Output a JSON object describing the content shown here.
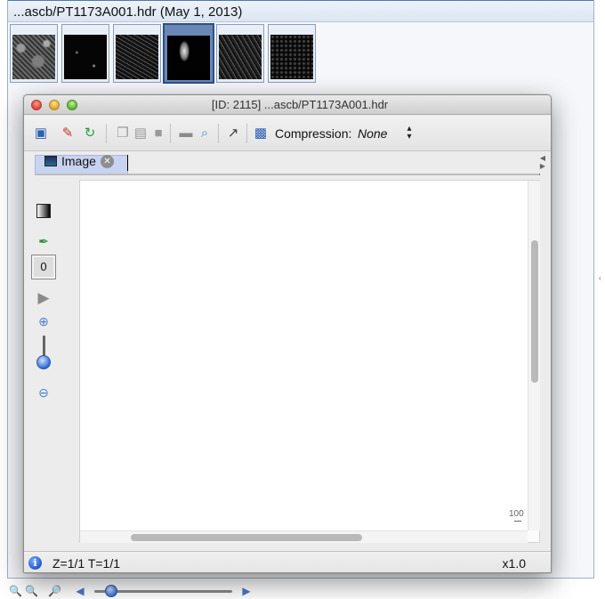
{
  "background_window": {
    "title": "...ascb/PT1173A001.hdr (May 1, 2013)",
    "thumbnails": [
      {
        "selected": false
      },
      {
        "selected": false
      },
      {
        "selected": false
      },
      {
        "selected": true
      },
      {
        "selected": false
      },
      {
        "selected": false
      }
    ],
    "bottom_toolbar": {
      "icons": [
        "zoom-out-icon",
        "zoom-in-icon",
        "zoom-fit-icon",
        "arrow-left-icon",
        "arrow-right-icon"
      ],
      "slider_value_fraction": 0.13
    }
  },
  "viewer": {
    "title": "[ID: 2115] ...ascb/PT1173A001.hdr",
    "toolbar": {
      "icons": [
        "measurement-icon",
        "annotate-icon",
        "refresh-icon",
        "copy-icon",
        "paste-icon",
        "save-icon",
        "movie-icon",
        "search-icon",
        "picker-icon",
        "screenshot-icon"
      ],
      "compression_label": "Compression:",
      "compression_value": "None"
    },
    "tab": {
      "label": "Image",
      "icon": "image-icon"
    },
    "side_tools": {
      "icons": [
        "gradient-icon",
        "color-picker-icon",
        "play-icon",
        "zoom-in-icon",
        "zoom-out-icon"
      ],
      "channel_value": "0",
      "zoom_slider_fraction": 0.75
    },
    "canvas": {
      "scale_label": "100"
    },
    "status": {
      "text": "Z=1/1 T=1/1",
      "zoom": "x1.0"
    }
  },
  "colors": {
    "title_blue": "#5479a7",
    "selection_blue": "#2c4f86",
    "tab_background": "#c8d3f0",
    "slider_blue": "#3b73d1"
  }
}
